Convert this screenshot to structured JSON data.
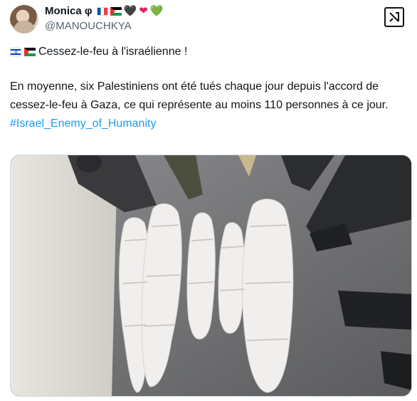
{
  "author": {
    "name": "Monica φ",
    "handle": "@MANOUCHKYA",
    "hearts": [
      "🖤",
      "❤",
      "💚"
    ]
  },
  "post": {
    "headline": "Cessez-le-feu à l'israélienne !",
    "body": "En moyenne, six Palestiniens ont été tués chaque jour depuis l'accord de cessez-le-feu à Gaza, ce qui représente au moins 110 personnes à ce jour.",
    "hashtag": "#Israel_Enemy_of_Humanity"
  },
  "icons": {
    "grok": "grok-icon",
    "flag_fr": "flag-france-icon",
    "flag_ps": "flag-palestine-icon",
    "flag_il": "flag-israel-icon"
  },
  "colors": {
    "text": "#0f1419",
    "secondary": "#536471",
    "link": "#1d9bf0"
  }
}
